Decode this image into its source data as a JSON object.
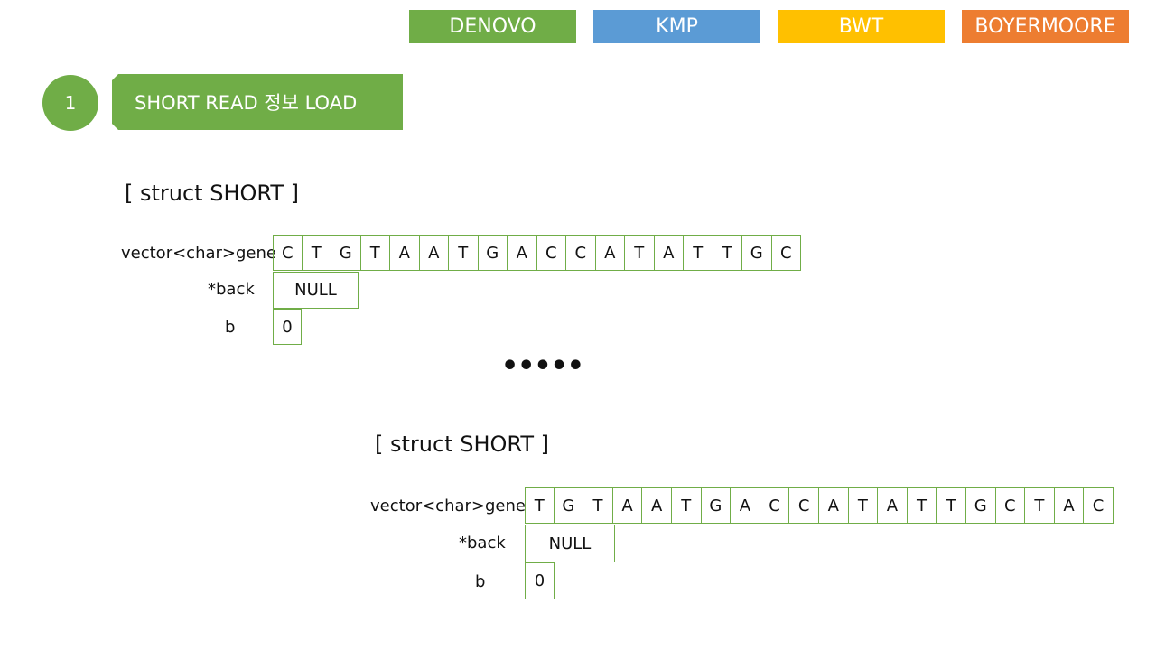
{
  "tabs": [
    {
      "label": "DENOVO",
      "color": "#70ad47"
    },
    {
      "label": "KMP",
      "color": "#5b9bd5"
    },
    {
      "label": "BWT",
      "color": "#ffc000"
    },
    {
      "label": "BOYERMOORE",
      "color": "#ed7d31"
    }
  ],
  "step": {
    "number": "1",
    "title": "SHORT READ 정보 LOAD"
  },
  "ellipsis": "•••••",
  "structs": [
    {
      "title": "[ struct SHORT ]",
      "gene_label": "vector<char>gene",
      "back_label": "*back",
      "b_label": "b",
      "gene": [
        "C",
        "T",
        "G",
        "T",
        "A",
        "A",
        "T",
        "G",
        "A",
        "C",
        "C",
        "A",
        "T",
        "A",
        "T",
        "T",
        "G",
        "C"
      ],
      "back_value": "NULL",
      "b_value": "0"
    },
    {
      "title": "[ struct SHORT ]",
      "gene_label": "vector<char>gene",
      "back_label": "*back",
      "b_label": "b",
      "gene": [
        "T",
        "G",
        "T",
        "A",
        "A",
        "T",
        "G",
        "A",
        "C",
        "C",
        "A",
        "T",
        "A",
        "T",
        "T",
        "G",
        "C",
        "T",
        "A",
        "C"
      ],
      "back_value": "NULL",
      "b_value": "0"
    }
  ]
}
